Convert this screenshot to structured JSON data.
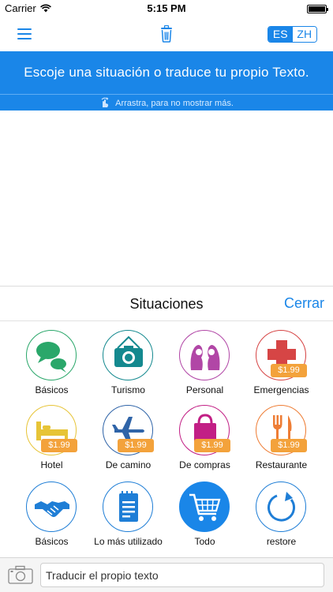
{
  "status_bar": {
    "carrier": "Carrier",
    "time": "5:15 PM"
  },
  "nav": {
    "lang_left": "ES",
    "lang_right": "ZH",
    "active_lang": "ES"
  },
  "banner": {
    "text": "Escoje una situación o traduce tu propio Texto.",
    "hint": "Arrastra, para no mostrar más."
  },
  "sheet": {
    "title": "Situaciones",
    "close_label": "Cerrar"
  },
  "situations": [
    {
      "label": "Básicos",
      "icon": "chat-bubbles-icon",
      "price": null,
      "color": "#2aa76a"
    },
    {
      "label": "Turismo",
      "icon": "camera-icon",
      "price": null,
      "color": "#14898f"
    },
    {
      "label": "Personal",
      "icon": "couple-icon",
      "price": null,
      "color": "#b146a6"
    },
    {
      "label": "Emergencias",
      "icon": "medical-cross-icon",
      "price": "$1.99",
      "color": "#d64545"
    },
    {
      "label": "Hotel",
      "icon": "bed-icon",
      "price": "$1.99",
      "color": "#e7c437"
    },
    {
      "label": "De camino",
      "icon": "airplane-icon",
      "price": "$1.99",
      "color": "#2f64a8"
    },
    {
      "label": "De compras",
      "icon": "shopping-bag-icon",
      "price": "$1.99",
      "color": "#c21f85"
    },
    {
      "label": "Restaurante",
      "icon": "fork-knife-icon",
      "price": "$1.99",
      "color": "#ee7d35"
    },
    {
      "label": "Básicos",
      "icon": "handshake-icon",
      "price": null,
      "color": "#1f7ed6"
    },
    {
      "label": "Lo más utilizado",
      "icon": "notepad-icon",
      "price": null,
      "color": "#1f7ed6"
    },
    {
      "label": "Todo",
      "icon": "shopping-cart-icon",
      "price": null,
      "color": "#1a86e8"
    },
    {
      "label": "restore",
      "icon": "restore-icon",
      "price": null,
      "color": "#1f7ed6"
    }
  ],
  "input": {
    "placeholder": "Traducir el propio texto"
  },
  "colors": {
    "accent": "#1a86e8",
    "price_tag": "#f3a23b"
  }
}
